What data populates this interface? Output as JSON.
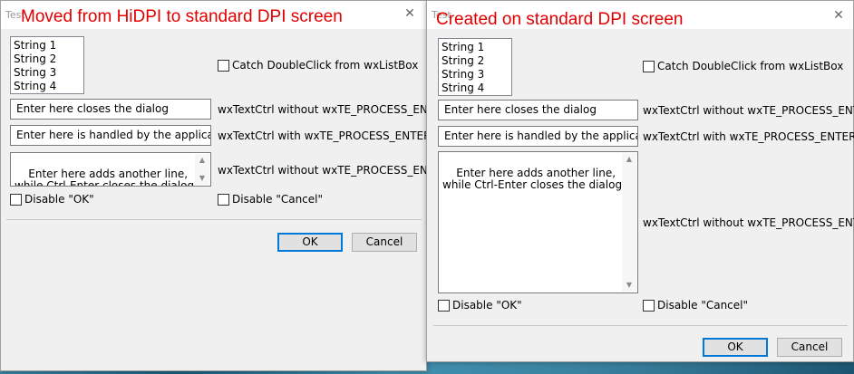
{
  "left_dialog": {
    "title": "Test",
    "overlay": "Moved from HiDPI to standard DPI screen",
    "close_glyph": "✕",
    "listbox_items": [
      "String 1",
      "String 2",
      "String 3",
      "String 4"
    ],
    "catch_doubleclick_label": "Catch DoubleClick from wxListBox",
    "text1_value": "Enter here closes the dialog",
    "text1_desc": "wxTextCtrl without wxTE_PROCESS_ENTER",
    "text2_value": "Enter here is handled by the application",
    "text2_desc": "wxTextCtrl with wxTE_PROCESS_ENTER",
    "text3_value": "Enter here adds another line,\nwhile Ctrl-Enter closes the dialog",
    "text3_desc": "wxTextCtrl without wxTE_PROCESS_ENTER",
    "disable_ok_label": "Disable \"OK\"",
    "disable_cancel_label": "Disable \"Cancel\"",
    "ok_label": "OK",
    "cancel_label": "Cancel"
  },
  "right_dialog": {
    "title": "Test",
    "overlay": "Created on standard DPI screen",
    "close_glyph": "✕",
    "listbox_items": [
      "String 1",
      "String 2",
      "String 3",
      "String 4"
    ],
    "catch_doubleclick_label": "Catch DoubleClick from wxListBox",
    "text1_value": "Enter here closes the dialog",
    "text1_desc": "wxTextCtrl without wxTE_PROCESS_ENTER",
    "text2_value": "Enter here is handled by the application",
    "text2_desc": "wxTextCtrl with wxTE_PROCESS_ENTER",
    "text3_value": "Enter here adds another line,\nwhile Ctrl-Enter closes the dialog",
    "text3_desc": "wxTextCtrl without wxTE_PROCESS_ENTER",
    "disable_ok_label": "Disable \"OK\"",
    "disable_cancel_label": "Disable \"Cancel\"",
    "ok_label": "OK",
    "cancel_label": "Cancel"
  },
  "colors": {
    "overlay_text": "#e00000",
    "dialog_bg": "#f0f0f0",
    "default_button_border": "#0078d7"
  }
}
